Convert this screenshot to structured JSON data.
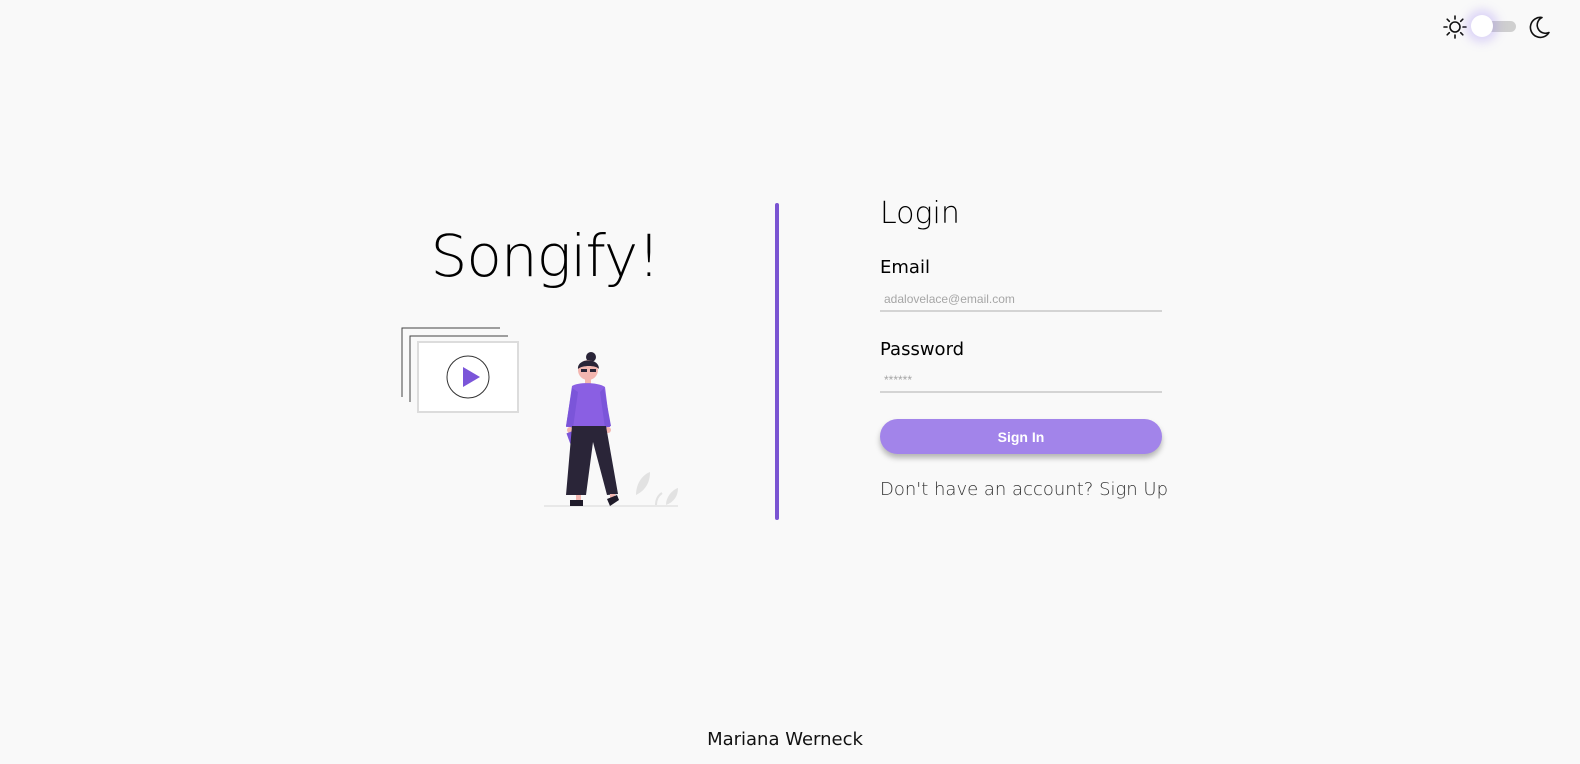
{
  "theme_toggle": {
    "left_icon": "sun-icon",
    "right_icon": "moon-icon",
    "state": "light"
  },
  "brand": {
    "title": "Songify!"
  },
  "illustration": {
    "icons": [
      "video-play-icon",
      "person-illustration",
      "plant-icon"
    ],
    "accent_color": "#7b55d9"
  },
  "divider": {
    "color": "#7a54d2"
  },
  "login": {
    "heading": "Login",
    "email_label": "Email",
    "email_placeholder": "adalovelace@email.com",
    "password_label": "Password",
    "password_placeholder": "******",
    "sign_in_label": "Sign In",
    "signup_prompt": "Don't have an account?",
    "signup_link": "Sign Up",
    "button_color": "#a284ea"
  },
  "footer": {
    "credit": "Mariana Werneck"
  }
}
